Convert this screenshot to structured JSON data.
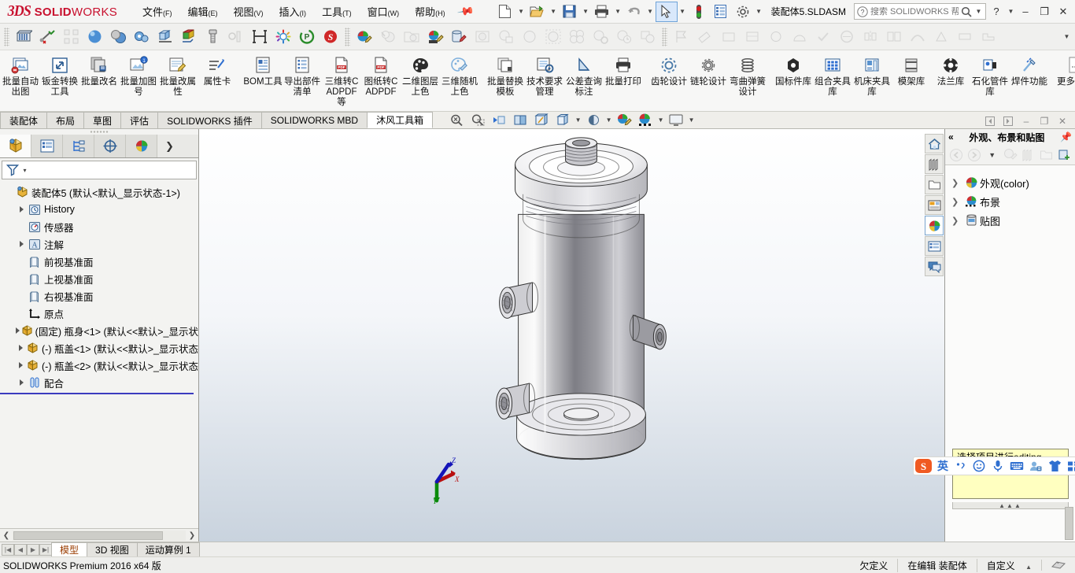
{
  "app": {
    "brand_ds": "3DS",
    "brand_solid": "SOLID",
    "brand_works": "WORKS",
    "document_name": "装配体5.SLDASM",
    "edition": "SOLIDWORKS Premium 2016 x64 版",
    "accent": "#c8102e",
    "highlight": "#d9e8fb"
  },
  "menu": {
    "items": [
      {
        "label": "文件",
        "accel": "(F)",
        "name": "menu-file"
      },
      {
        "label": "编辑",
        "accel": "(E)",
        "name": "menu-edit"
      },
      {
        "label": "视图",
        "accel": "(V)",
        "name": "menu-view"
      },
      {
        "label": "插入",
        "accel": "(I)",
        "name": "menu-insert"
      },
      {
        "label": "工具",
        "accel": "(T)",
        "name": "menu-tools"
      },
      {
        "label": "窗口",
        "accel": "(W)",
        "name": "menu-window"
      },
      {
        "label": "帮助",
        "accel": "(H)",
        "name": "menu-help"
      }
    ],
    "pin_icon": "pin-icon"
  },
  "quickbar": {
    "items": [
      {
        "name": "new-document-button",
        "icon": "new-file-icon",
        "has_caret": true
      },
      {
        "name": "open-document-button",
        "icon": "open-folder-icon",
        "has_caret": true
      },
      {
        "name": "save-button",
        "icon": "save-disk-icon",
        "has_caret": true
      },
      {
        "name": "print-button",
        "icon": "printer-icon",
        "has_caret": true
      },
      {
        "name": "undo-button",
        "icon": "undo-arrow-icon",
        "has_caret": true
      },
      {
        "name": "select-button",
        "icon": "cursor-arrow-icon",
        "has_caret": true
      },
      {
        "name": "rebuild-button",
        "icon": "traffic-light-icon",
        "has_caret": false
      },
      {
        "name": "options-list-button",
        "icon": "list-panel-icon",
        "has_caret": false
      },
      {
        "name": "settings-button",
        "icon": "gear-icon",
        "has_caret": true
      }
    ]
  },
  "search": {
    "placeholder": "搜索 SOLIDWORKS 帮助",
    "value": "",
    "icon": "search-magnifier-icon",
    "help_icon": "question-help-icon"
  },
  "window_controls": {
    "minimize": "–",
    "restore": "❐",
    "close": "✕"
  },
  "ribbon": {
    "groups": [
      {
        "name": "group-batch-tools",
        "buttons": [
          {
            "name": "batch-auto-drawing",
            "label": "批量自动出图",
            "icon": "batch-drawing-icon"
          },
          {
            "name": "sheetmetal-convert",
            "label": "钣金转换工具",
            "icon": "sheetmetal-icon"
          },
          {
            "name": "batch-rename",
            "label": "批量改名",
            "icon": "rename-icon"
          },
          {
            "name": "batch-add-number",
            "label": "批量加图号",
            "icon": "add-number-icon"
          },
          {
            "name": "batch-edit-property",
            "label": "批量改属性",
            "icon": "edit-property-icon"
          },
          {
            "name": "property-card",
            "label": "属性卡",
            "icon": "property-card-icon"
          }
        ]
      },
      {
        "name": "group-export",
        "buttons": [
          {
            "name": "bom-tool",
            "label": "BOM工具",
            "icon": "bom-icon"
          },
          {
            "name": "export-part-list",
            "label": "导出部件清单",
            "icon": "export-list-icon"
          },
          {
            "name": "cad3d-to-pdf",
            "label": "三维转CADPDF等",
            "icon": "pdf-3d-icon"
          },
          {
            "name": "drawing-to-cadpdf",
            "label": "图纸转CADPDF",
            "icon": "pdf-drawing-icon"
          },
          {
            "name": "2d-layer-color",
            "label": "二维图层上色",
            "icon": "palette-icon"
          },
          {
            "name": "3d-random-color",
            "label": "三维随机上色",
            "icon": "random-color-icon"
          }
        ]
      },
      {
        "name": "group-manage",
        "buttons": [
          {
            "name": "batch-replace-template",
            "label": "批量替换模板",
            "icon": "replace-template-icon"
          },
          {
            "name": "tech-requirement-mgmt",
            "label": "技术要求管理",
            "icon": "tech-req-icon"
          },
          {
            "name": "tolerance-annotation",
            "label": "公差查询标注",
            "icon": "tolerance-icon"
          },
          {
            "name": "batch-print",
            "label": "批量打印",
            "icon": "print-batch-icon"
          }
        ]
      },
      {
        "name": "group-design",
        "buttons": [
          {
            "name": "gear-design",
            "label": "齿轮设计",
            "icon": "gear-design-icon"
          },
          {
            "name": "sprocket-design",
            "label": "链轮设计",
            "icon": "sprocket-icon"
          },
          {
            "name": "spring-design",
            "label": "弯曲弹簧设计",
            "icon": "spring-icon"
          }
        ]
      },
      {
        "name": "group-libraries",
        "buttons": [
          {
            "name": "standard-parts-library",
            "label": "国标件库",
            "icon": "hex-nut-icon"
          },
          {
            "name": "fixture-library",
            "label": "组合夹具库",
            "icon": "fixture-grid-icon"
          },
          {
            "name": "machine-fixture-library",
            "label": "机床夹具库",
            "icon": "machine-fixture-icon"
          },
          {
            "name": "mold-base-library",
            "label": "模架库",
            "icon": "mold-base-icon"
          },
          {
            "name": "flange-library",
            "label": "法兰库",
            "icon": "flange-icon"
          },
          {
            "name": "petrochem-pipe-library",
            "label": "石化管件库",
            "icon": "pipe-icon"
          },
          {
            "name": "weldment-function",
            "label": "焊件功能",
            "icon": "weld-icon"
          }
        ]
      },
      {
        "name": "group-more",
        "buttons": [
          {
            "name": "more-functions",
            "label": "更多功能",
            "icon": "more-doc-icon"
          }
        ]
      }
    ],
    "overflow_icon": "chevron-double-right-icon"
  },
  "doc_tabs": {
    "items": [
      {
        "label": "装配体",
        "name": "tab-assembly",
        "active": false
      },
      {
        "label": "布局",
        "name": "tab-layout",
        "active": false
      },
      {
        "label": "草图",
        "name": "tab-sketch",
        "active": false
      },
      {
        "label": "评估",
        "name": "tab-evaluate",
        "active": false
      },
      {
        "label": "SOLIDWORKS 插件",
        "name": "tab-sw-addins",
        "active": false
      },
      {
        "label": "SOLIDWORKS MBD",
        "name": "tab-sw-mbd",
        "active": false
      },
      {
        "label": "沐风工具箱",
        "name": "tab-mufeng-toolbox",
        "active": true
      }
    ]
  },
  "viewport_tools": {
    "items": [
      {
        "name": "zoom-to-fit-button",
        "icon": "zoom-fit-icon"
      },
      {
        "name": "zoom-to-area-button",
        "icon": "zoom-area-icon"
      },
      {
        "name": "previous-view-button",
        "icon": "previous-view-icon"
      },
      {
        "name": "section-view-button",
        "icon": "section-view-icon"
      },
      {
        "name": "view-orientation-button",
        "icon": "view-orientation-icon"
      },
      {
        "name": "display-style-button",
        "icon": "display-style-icon",
        "has_caret": true
      },
      {
        "name": "hide-show-items-button",
        "icon": "hide-show-icon",
        "has_caret": true
      },
      {
        "name": "apply-scene-button",
        "icon": "scene-sphere-icon",
        "has_caret": true
      },
      {
        "name": "edit-appearance-button",
        "icon": "appearance-edit-icon",
        "has_caret": true
      },
      {
        "name": "view-settings-button",
        "icon": "monitor-icon",
        "has_caret": true
      }
    ]
  },
  "doc_window_controls": {
    "prev": "◁",
    "next": "▷",
    "minimize": "–",
    "restore": "❐",
    "close": "✕"
  },
  "feature_manager": {
    "tabs": [
      {
        "name": "feature-tree-tab",
        "icon": "feature-tree-icon",
        "active": true
      },
      {
        "name": "property-manager-tab",
        "icon": "property-manager-icon",
        "active": false
      },
      {
        "name": "configuration-manager-tab",
        "icon": "configuration-icon",
        "active": false
      },
      {
        "name": "dimxpert-tab",
        "icon": "dimxpert-icon",
        "active": false
      },
      {
        "name": "display-manager-tab",
        "icon": "display-manager-icon",
        "active": false
      }
    ],
    "expand_icon": "chevron-right-icon",
    "filter_icon": "filter-funnel-icon",
    "root": {
      "label": "装配体5  (默认<默认_显示状态-1>)",
      "icon": "assembly-icon"
    },
    "items": [
      {
        "label": "History",
        "icon": "history-icon",
        "expandable": true,
        "indent": 1
      },
      {
        "label": "传感器",
        "icon": "sensor-icon",
        "expandable": false,
        "indent": 1
      },
      {
        "label": "注解",
        "icon": "annotation-icon",
        "expandable": true,
        "indent": 1
      },
      {
        "label": "前视基准面",
        "icon": "plane-icon",
        "expandable": false,
        "indent": 1
      },
      {
        "label": "上视基准面",
        "icon": "plane-icon",
        "expandable": false,
        "indent": 1
      },
      {
        "label": "右视基准面",
        "icon": "plane-icon",
        "expandable": false,
        "indent": 1
      },
      {
        "label": "原点",
        "icon": "origin-icon",
        "expandable": false,
        "indent": 1
      },
      {
        "label": "(固定) 瓶身<1>  (默认<<默认>_显示状",
        "icon": "part-icon",
        "expandable": true,
        "indent": 1
      },
      {
        "label": "(-) 瓶盖<1>  (默认<<默认>_显示状态",
        "icon": "part-icon",
        "expandable": true,
        "indent": 1
      },
      {
        "label": "(-) 瓶盖<2>  (默认<<默认>_显示状态",
        "icon": "part-icon",
        "expandable": true,
        "indent": 1
      },
      {
        "label": "配合",
        "icon": "mates-icon",
        "expandable": true,
        "indent": 1
      }
    ]
  },
  "task_panel": {
    "title": "外观、布景和贴图",
    "collapse_icon": "chevron-double-left-icon",
    "pin_icon": "pin-icon",
    "tools": [
      {
        "name": "back-button",
        "icon": "back-arrow-icon"
      },
      {
        "name": "forward-button",
        "icon": "forward-arrow-icon"
      },
      {
        "name": "history-dropdown-button",
        "icon": "chevron-down-icon"
      },
      {
        "name": "appearance-edit-button",
        "icon": "appearance-pencil-icon"
      },
      {
        "name": "view-list-button",
        "icon": "books-icon"
      },
      {
        "name": "open-folder-button",
        "icon": "folder-icon"
      },
      {
        "name": "add-to-favorites-button",
        "icon": "add-favorite-icon"
      }
    ],
    "items": [
      {
        "label": "外观(color)",
        "icon": "appearance-sphere-icon",
        "name": "tp-item-appearance"
      },
      {
        "label": "布景",
        "icon": "scene-sphere-icon",
        "name": "tp-item-scene"
      },
      {
        "label": "贴图",
        "icon": "decal-icon",
        "name": "tp-item-decal"
      }
    ],
    "hint_text": "选择项目进行editing",
    "dots": "▲▲▲"
  },
  "view_rail": {
    "items": [
      {
        "name": "rail-home-button",
        "icon": "home-icon"
      },
      {
        "name": "rail-design-library-button",
        "icon": "library-books-icon"
      },
      {
        "name": "rail-file-explorer-button",
        "icon": "folder-icon"
      },
      {
        "name": "rail-view-palette-button",
        "icon": "view-palette-icon"
      },
      {
        "name": "rail-appearances-button",
        "icon": "appearance-sphere-icon",
        "active": true
      },
      {
        "name": "rail-custom-properties-button",
        "icon": "custom-properties-icon"
      },
      {
        "name": "rail-forum-button",
        "icon": "chat-bubble-icon"
      }
    ]
  },
  "model": {
    "name": "pressure-vessel-assembly",
    "triad_labels": {
      "x": "X",
      "y": "Y",
      "z": "Z"
    },
    "triad_colors": {
      "x": "#cc0000",
      "y": "#009900",
      "z": "#0000cc"
    }
  },
  "bottom_tabs": {
    "nav": [
      {
        "name": "first-tab-button",
        "glyph": "|◀"
      },
      {
        "name": "prev-tab-button",
        "glyph": "◀"
      },
      {
        "name": "next-tab-button",
        "glyph": "▶"
      },
      {
        "name": "last-tab-button",
        "glyph": "▶|"
      }
    ],
    "tabs": [
      {
        "label": "模型",
        "name": "bottom-tab-model",
        "active": true
      },
      {
        "label": "3D 视图",
        "name": "bottom-tab-3dview",
        "active": false
      },
      {
        "label": "运动算例 1",
        "name": "bottom-tab-motion-study",
        "active": false
      }
    ]
  },
  "status_bar": {
    "edition": "SOLIDWORKS Premium 2016 x64 版",
    "underdefined": "欠定义",
    "editing": "在编辑 装配体",
    "custom": "自定义",
    "custom_caret": "▲",
    "sw_icon": "solidworks-status-icon"
  },
  "ime": {
    "logo": "sogou-logo-icon",
    "mode_label": "英",
    "buttons": [
      {
        "name": "ime-punctuation-button",
        "icon": "comma-icon"
      },
      {
        "name": "ime-emoji-button",
        "icon": "smiley-icon"
      },
      {
        "name": "ime-voice-button",
        "icon": "microphone-icon"
      },
      {
        "name": "ime-keyboard-button",
        "icon": "keyboard-icon"
      },
      {
        "name": "ime-account-button",
        "icon": "user-icon"
      },
      {
        "name": "ime-skin-button",
        "icon": "tshirt-icon"
      },
      {
        "name": "ime-toolbox-button",
        "icon": "grid-squares-icon"
      }
    ]
  }
}
